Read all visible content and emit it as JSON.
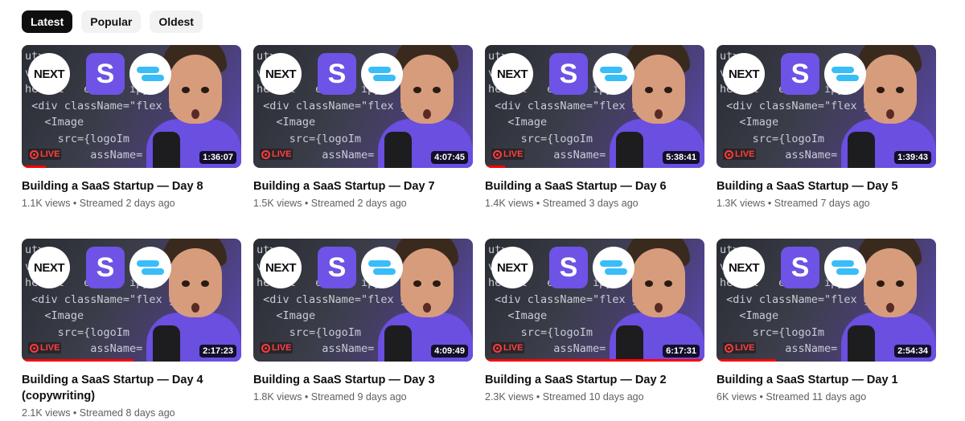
{
  "filters": [
    {
      "label": "Latest",
      "active": true
    },
    {
      "label": "Popular",
      "active": false
    },
    {
      "label": "Oldest",
      "active": false
    }
  ],
  "thumbnail_text": {
    "next_logo": "NEXT",
    "s_logo": "S",
    "live_badge": "LIVE",
    "code_lines": [
      "ut>",
      "v Na  s         -hid",
      "he  cl   e=     ipy-2",
      " <div className=\"flex g  tems-",
      "   <Image",
      "     src={logoIm",
      "          assName="
    ]
  },
  "colors": {
    "live_red": "#ff0000",
    "s_logo_bg": "#6e53e6",
    "tailwind_blue": "#38bdf8",
    "active_chip": "#0f0f0f"
  },
  "videos": [
    {
      "title": "Building a SaaS Startup — Day 8",
      "duration": "1:36:07",
      "views": "1.1K views",
      "age": "Streamed 2 days ago",
      "watched_fraction": 0.11
    },
    {
      "title": "Building a SaaS Startup — Day 7",
      "duration": "4:07:45",
      "views": "1.5K views",
      "age": "Streamed 2 days ago",
      "watched_fraction": 0.0
    },
    {
      "title": "Building a SaaS Startup — Day 6",
      "duration": "5:38:41",
      "views": "1.4K views",
      "age": "Streamed 3 days ago",
      "watched_fraction": 0.09
    },
    {
      "title": "Building a SaaS Startup — Day 5",
      "duration": "1:39:43",
      "views": "1.3K views",
      "age": "Streamed 7 days ago",
      "watched_fraction": 0.0
    },
    {
      "title": "Building a SaaS Startup — Day 4 (copywriting)",
      "duration": "2:17:23",
      "views": "2.1K views",
      "age": "Streamed 8 days ago",
      "watched_fraction": 0.51
    },
    {
      "title": "Building a SaaS Startup — Day 3",
      "duration": "4:09:49",
      "views": "1.8K views",
      "age": "Streamed 9 days ago",
      "watched_fraction": 0.0
    },
    {
      "title": "Building a SaaS Startup — Day 2",
      "duration": "6:17:31",
      "views": "2.3K views",
      "age": "Streamed 10 days ago",
      "watched_fraction": 1.0
    },
    {
      "title": "Building a SaaS Startup — Day 1",
      "duration": "2:54:34",
      "views": "6K views",
      "age": "Streamed 11 days ago",
      "watched_fraction": 0.27
    }
  ]
}
